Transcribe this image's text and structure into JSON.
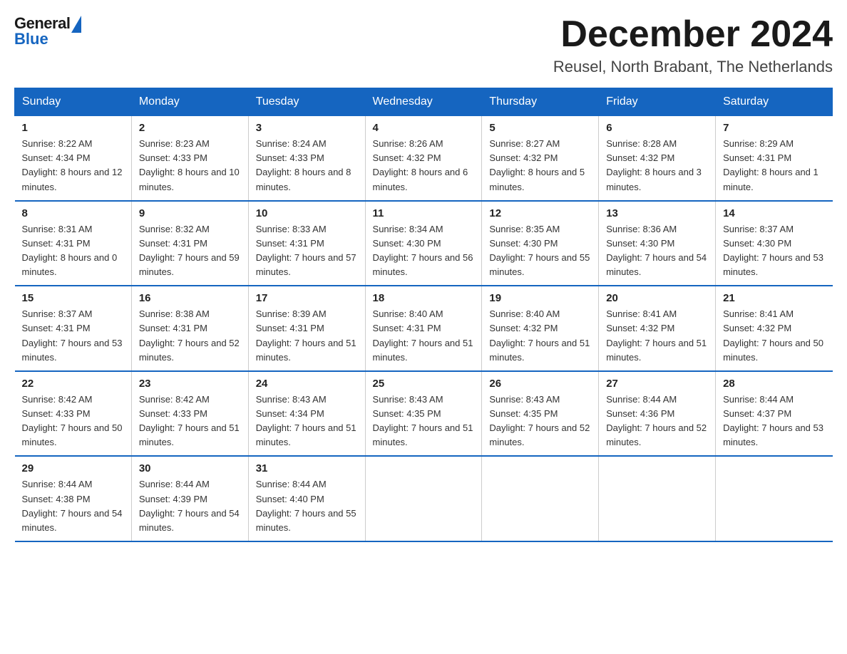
{
  "header": {
    "logo_general": "General",
    "logo_blue": "Blue",
    "month_title": "December 2024",
    "location": "Reusel, North Brabant, The Netherlands"
  },
  "days_of_week": [
    "Sunday",
    "Monday",
    "Tuesday",
    "Wednesday",
    "Thursday",
    "Friday",
    "Saturday"
  ],
  "weeks": [
    [
      {
        "day": "1",
        "sunrise": "8:22 AM",
        "sunset": "4:34 PM",
        "daylight": "8 hours and 12 minutes."
      },
      {
        "day": "2",
        "sunrise": "8:23 AM",
        "sunset": "4:33 PM",
        "daylight": "8 hours and 10 minutes."
      },
      {
        "day": "3",
        "sunrise": "8:24 AM",
        "sunset": "4:33 PM",
        "daylight": "8 hours and 8 minutes."
      },
      {
        "day": "4",
        "sunrise": "8:26 AM",
        "sunset": "4:32 PM",
        "daylight": "8 hours and 6 minutes."
      },
      {
        "day": "5",
        "sunrise": "8:27 AM",
        "sunset": "4:32 PM",
        "daylight": "8 hours and 5 minutes."
      },
      {
        "day": "6",
        "sunrise": "8:28 AM",
        "sunset": "4:32 PM",
        "daylight": "8 hours and 3 minutes."
      },
      {
        "day": "7",
        "sunrise": "8:29 AM",
        "sunset": "4:31 PM",
        "daylight": "8 hours and 1 minute."
      }
    ],
    [
      {
        "day": "8",
        "sunrise": "8:31 AM",
        "sunset": "4:31 PM",
        "daylight": "8 hours and 0 minutes."
      },
      {
        "day": "9",
        "sunrise": "8:32 AM",
        "sunset": "4:31 PM",
        "daylight": "7 hours and 59 minutes."
      },
      {
        "day": "10",
        "sunrise": "8:33 AM",
        "sunset": "4:31 PM",
        "daylight": "7 hours and 57 minutes."
      },
      {
        "day": "11",
        "sunrise": "8:34 AM",
        "sunset": "4:30 PM",
        "daylight": "7 hours and 56 minutes."
      },
      {
        "day": "12",
        "sunrise": "8:35 AM",
        "sunset": "4:30 PM",
        "daylight": "7 hours and 55 minutes."
      },
      {
        "day": "13",
        "sunrise": "8:36 AM",
        "sunset": "4:30 PM",
        "daylight": "7 hours and 54 minutes."
      },
      {
        "day": "14",
        "sunrise": "8:37 AM",
        "sunset": "4:30 PM",
        "daylight": "7 hours and 53 minutes."
      }
    ],
    [
      {
        "day": "15",
        "sunrise": "8:37 AM",
        "sunset": "4:31 PM",
        "daylight": "7 hours and 53 minutes."
      },
      {
        "day": "16",
        "sunrise": "8:38 AM",
        "sunset": "4:31 PM",
        "daylight": "7 hours and 52 minutes."
      },
      {
        "day": "17",
        "sunrise": "8:39 AM",
        "sunset": "4:31 PM",
        "daylight": "7 hours and 51 minutes."
      },
      {
        "day": "18",
        "sunrise": "8:40 AM",
        "sunset": "4:31 PM",
        "daylight": "7 hours and 51 minutes."
      },
      {
        "day": "19",
        "sunrise": "8:40 AM",
        "sunset": "4:32 PM",
        "daylight": "7 hours and 51 minutes."
      },
      {
        "day": "20",
        "sunrise": "8:41 AM",
        "sunset": "4:32 PM",
        "daylight": "7 hours and 51 minutes."
      },
      {
        "day": "21",
        "sunrise": "8:41 AM",
        "sunset": "4:32 PM",
        "daylight": "7 hours and 50 minutes."
      }
    ],
    [
      {
        "day": "22",
        "sunrise": "8:42 AM",
        "sunset": "4:33 PM",
        "daylight": "7 hours and 50 minutes."
      },
      {
        "day": "23",
        "sunrise": "8:42 AM",
        "sunset": "4:33 PM",
        "daylight": "7 hours and 51 minutes."
      },
      {
        "day": "24",
        "sunrise": "8:43 AM",
        "sunset": "4:34 PM",
        "daylight": "7 hours and 51 minutes."
      },
      {
        "day": "25",
        "sunrise": "8:43 AM",
        "sunset": "4:35 PM",
        "daylight": "7 hours and 51 minutes."
      },
      {
        "day": "26",
        "sunrise": "8:43 AM",
        "sunset": "4:35 PM",
        "daylight": "7 hours and 52 minutes."
      },
      {
        "day": "27",
        "sunrise": "8:44 AM",
        "sunset": "4:36 PM",
        "daylight": "7 hours and 52 minutes."
      },
      {
        "day": "28",
        "sunrise": "8:44 AM",
        "sunset": "4:37 PM",
        "daylight": "7 hours and 53 minutes."
      }
    ],
    [
      {
        "day": "29",
        "sunrise": "8:44 AM",
        "sunset": "4:38 PM",
        "daylight": "7 hours and 54 minutes."
      },
      {
        "day": "30",
        "sunrise": "8:44 AM",
        "sunset": "4:39 PM",
        "daylight": "7 hours and 54 minutes."
      },
      {
        "day": "31",
        "sunrise": "8:44 AM",
        "sunset": "4:40 PM",
        "daylight": "7 hours and 55 minutes."
      },
      null,
      null,
      null,
      null
    ]
  ],
  "labels": {
    "sunrise": "Sunrise:",
    "sunset": "Sunset:",
    "daylight": "Daylight:"
  }
}
